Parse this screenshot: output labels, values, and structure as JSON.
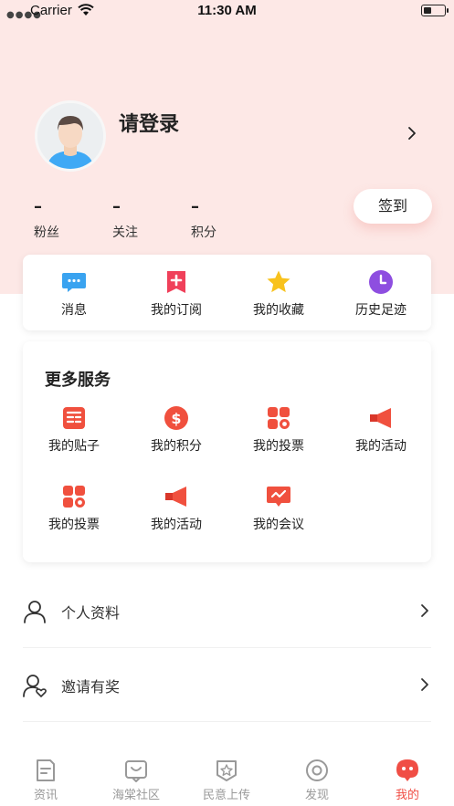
{
  "status_bar": {
    "carrier": "Carrier",
    "time": "11:30 AM"
  },
  "profile": {
    "login_text": "请登录"
  },
  "stats": [
    {
      "value": "–",
      "label": "粉丝"
    },
    {
      "value": "–",
      "label": "关注"
    },
    {
      "value": "–",
      "label": "积分"
    }
  ],
  "signin_label": "签到",
  "quick_actions": [
    {
      "label": "消息",
      "icon": "message-icon"
    },
    {
      "label": "我的订阅",
      "icon": "subscription-icon"
    },
    {
      "label": "我的收藏",
      "icon": "star-icon"
    },
    {
      "label": "历史足迹",
      "icon": "clock-icon"
    }
  ],
  "services": {
    "title": "更多服务",
    "items": [
      {
        "label": "我的贴子",
        "icon": "posts-icon"
      },
      {
        "label": "我的积分",
        "icon": "points-icon"
      },
      {
        "label": "我的投票",
        "icon": "vote-icon"
      },
      {
        "label": "我的活动",
        "icon": "activity-icon"
      },
      {
        "label": "我的投票",
        "icon": "vote-icon"
      },
      {
        "label": "我的活动",
        "icon": "activity-icon"
      },
      {
        "label": "我的会议",
        "icon": "meeting-icon"
      }
    ]
  },
  "menu": [
    {
      "label": "个人资料",
      "icon": "user-icon"
    },
    {
      "label": "邀请有奖",
      "icon": "invite-user-icon"
    }
  ],
  "tabbar": [
    {
      "label": "资讯",
      "icon": "news-icon"
    },
    {
      "label": "海棠社区",
      "icon": "community-icon"
    },
    {
      "label": "民意上传",
      "icon": "upload-shield-icon"
    },
    {
      "label": "发现",
      "icon": "discover-icon"
    },
    {
      "label": "我的",
      "icon": "mine-icon",
      "active": true
    }
  ],
  "colors": {
    "accent": "#f04e45",
    "hero_bg": "#fde8e6",
    "tab_inactive": "#999999"
  }
}
